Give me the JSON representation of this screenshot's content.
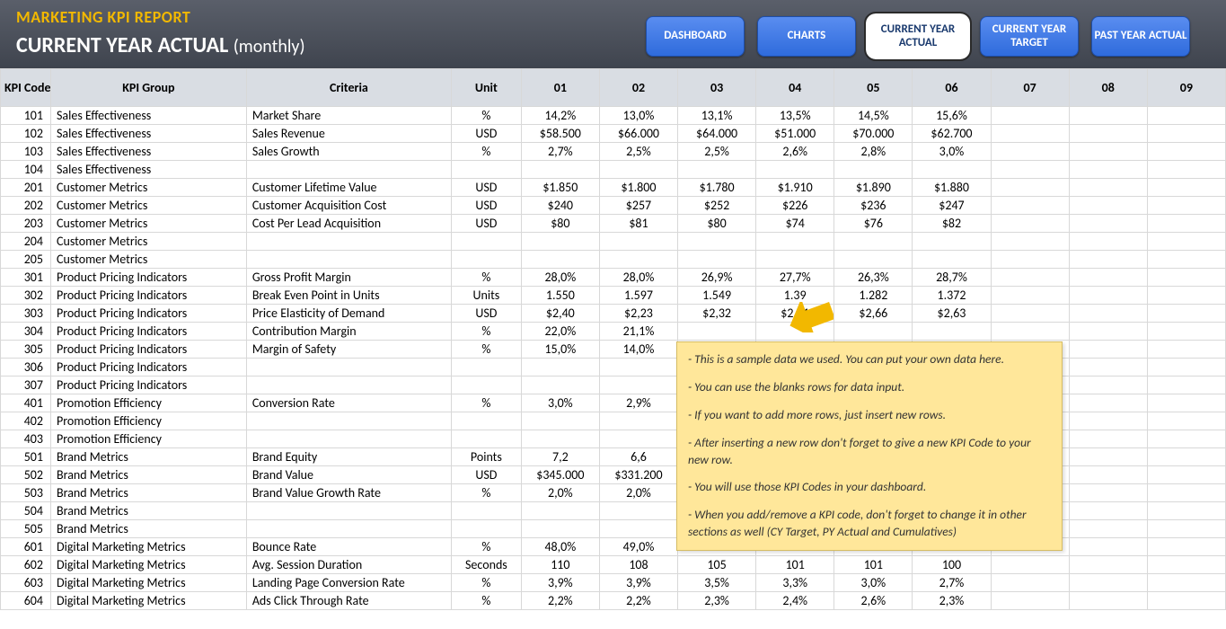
{
  "header": {
    "title": "MARKETING KPI REPORT",
    "subtitle_main": "CURRENT YEAR ACTUAL",
    "subtitle_suffix": "(monthly)"
  },
  "nav": {
    "dashboard": "DASHBOARD",
    "charts": "CHARTS",
    "cy_actual": "CURRENT YEAR ACTUAL",
    "cy_target": "CURRENT YEAR TARGET",
    "py_actual": "PAST YEAR ACTUAL"
  },
  "columns": {
    "code": "KPI Code",
    "group": "KPI Group",
    "criteria": "Criteria",
    "unit": "Unit",
    "m01": "01",
    "m02": "02",
    "m03": "03",
    "m04": "04",
    "m05": "05",
    "m06": "06",
    "m07": "07",
    "m08": "08",
    "m09": "09"
  },
  "rows": [
    {
      "code": "101",
      "group": "Sales Effectiveness",
      "criteria": "Market Share",
      "unit": "%",
      "v": [
        "14,2%",
        "13,0%",
        "13,1%",
        "13,5%",
        "14,5%",
        "15,6%",
        "",
        "",
        ""
      ]
    },
    {
      "code": "102",
      "group": "Sales Effectiveness",
      "criteria": "Sales Revenue",
      "unit": "USD",
      "v": [
        "$58.500",
        "$66.000",
        "$64.000",
        "$51.000",
        "$70.000",
        "$62.700",
        "",
        "",
        ""
      ]
    },
    {
      "code": "103",
      "group": "Sales Effectiveness",
      "criteria": "Sales Growth",
      "unit": "%",
      "v": [
        "2,7%",
        "2,5%",
        "2,5%",
        "2,6%",
        "2,8%",
        "3,0%",
        "",
        "",
        ""
      ]
    },
    {
      "code": "104",
      "group": "Sales Effectiveness",
      "criteria": "",
      "unit": "",
      "v": [
        "",
        "",
        "",
        "",
        "",
        "",
        "",
        "",
        ""
      ]
    },
    {
      "code": "201",
      "group": "Customer Metrics",
      "criteria": "Customer Lifetime Value",
      "unit": "USD",
      "v": [
        "$1.850",
        "$1.800",
        "$1.780",
        "$1.910",
        "$1.890",
        "$1.880",
        "",
        "",
        ""
      ]
    },
    {
      "code": "202",
      "group": "Customer Metrics",
      "criteria": "Customer Acquisition Cost",
      "unit": "USD",
      "v": [
        "$240",
        "$257",
        "$252",
        "$226",
        "$236",
        "$247",
        "",
        "",
        ""
      ]
    },
    {
      "code": "203",
      "group": "Customer Metrics",
      "criteria": "Cost Per Lead Acquisition",
      "unit": "USD",
      "v": [
        "$80",
        "$81",
        "$80",
        "$74",
        "$76",
        "$82",
        "",
        "",
        ""
      ]
    },
    {
      "code": "204",
      "group": "Customer Metrics",
      "criteria": "",
      "unit": "",
      "v": [
        "",
        "",
        "",
        "",
        "",
        "",
        "",
        "",
        ""
      ]
    },
    {
      "code": "205",
      "group": "Customer Metrics",
      "criteria": "",
      "unit": "",
      "v": [
        "",
        "",
        "",
        "",
        "",
        "",
        "",
        "",
        ""
      ]
    },
    {
      "code": "301",
      "group": "Product Pricing Indicators",
      "criteria": "Gross Profit Margin",
      "unit": "%",
      "v": [
        "28,0%",
        "28,0%",
        "26,9%",
        "27,7%",
        "26,3%",
        "28,7%",
        "",
        "",
        ""
      ]
    },
    {
      "code": "302",
      "group": "Product Pricing Indicators",
      "criteria": "Break Even Point in Units",
      "unit": "Units",
      "v": [
        "1.550",
        "1.597",
        "1.549",
        "1.39",
        "1.282",
        "1.372",
        "",
        "",
        ""
      ]
    },
    {
      "code": "303",
      "group": "Product Pricing Indicators",
      "criteria": "Price Elasticity of Demand",
      "unit": "USD",
      "v": [
        "$2,40",
        "$2,23",
        "$2,32",
        "$2,51",
        "$2,66",
        "$2,63",
        "",
        "",
        ""
      ]
    },
    {
      "code": "304",
      "group": "Product Pricing Indicators",
      "criteria": "Contribution Margin",
      "unit": "%",
      "v": [
        "22,0%",
        "21,1%",
        "",
        "",
        "",
        "",
        "",
        "",
        ""
      ]
    },
    {
      "code": "305",
      "group": "Product Pricing Indicators",
      "criteria": "Margin of Safety",
      "unit": "%",
      "v": [
        "15,0%",
        "14,0%",
        "",
        "",
        "",
        "",
        "",
        "",
        ""
      ]
    },
    {
      "code": "306",
      "group": "Product Pricing Indicators",
      "criteria": "",
      "unit": "",
      "v": [
        "",
        "",
        "",
        "",
        "",
        "",
        "",
        "",
        ""
      ]
    },
    {
      "code": "307",
      "group": "Product Pricing Indicators",
      "criteria": "",
      "unit": "",
      "v": [
        "",
        "",
        "",
        "",
        "",
        "",
        "",
        "",
        ""
      ]
    },
    {
      "code": "401",
      "group": "Promotion Efficiency",
      "criteria": "Conversion Rate",
      "unit": "%",
      "v": [
        "3,0%",
        "2,9%",
        "",
        "",
        "",
        "",
        "",
        "",
        ""
      ]
    },
    {
      "code": "402",
      "group": "Promotion Efficiency",
      "criteria": "",
      "unit": "",
      "v": [
        "",
        "",
        "",
        "",
        "",
        "",
        "",
        "",
        ""
      ]
    },
    {
      "code": "403",
      "group": "Promotion Efficiency",
      "criteria": "",
      "unit": "",
      "v": [
        "",
        "",
        "",
        "",
        "",
        "",
        "",
        "",
        ""
      ]
    },
    {
      "code": "501",
      "group": "Brand Metrics",
      "criteria": "Brand Equity",
      "unit": "Points",
      "v": [
        "7,2",
        "6,6",
        "",
        "",
        "",
        "",
        "",
        "",
        ""
      ]
    },
    {
      "code": "502",
      "group": "Brand Metrics",
      "criteria": "Brand Value",
      "unit": "USD",
      "v": [
        "$345.000",
        "$331.200",
        "",
        "",
        "",
        "",
        "",
        "",
        ""
      ]
    },
    {
      "code": "503",
      "group": "Brand Metrics",
      "criteria": "Brand Value Growth Rate",
      "unit": "%",
      "v": [
        "2,0%",
        "2,0%",
        "",
        "",
        "",
        "",
        "",
        "",
        ""
      ]
    },
    {
      "code": "504",
      "group": "Brand Metrics",
      "criteria": "",
      "unit": "",
      "v": [
        "",
        "",
        "",
        "",
        "",
        "",
        "",
        "",
        ""
      ]
    },
    {
      "code": "505",
      "group": "Brand Metrics",
      "criteria": "",
      "unit": "",
      "v": [
        "",
        "",
        "",
        "",
        "",
        "",
        "",
        "",
        ""
      ]
    },
    {
      "code": "601",
      "group": "Digital Marketing Metrics",
      "criteria": "Bounce Rate",
      "unit": "%",
      "v": [
        "48,0%",
        "49,0%",
        "",
        "",
        "",
        "",
        "",
        "",
        ""
      ]
    },
    {
      "code": "602",
      "group": "Digital Marketing Metrics",
      "criteria": "Avg. Session Duration",
      "unit": "Seconds",
      "v": [
        "110",
        "108",
        "105",
        "101",
        "101",
        "100",
        "",
        "",
        ""
      ]
    },
    {
      "code": "603",
      "group": "Digital Marketing Metrics",
      "criteria": "Landing Page Conversion Rate",
      "unit": "%",
      "v": [
        "3,9%",
        "3,9%",
        "3,5%",
        "3,3%",
        "3,0%",
        "2,7%",
        "",
        "",
        ""
      ]
    },
    {
      "code": "604",
      "group": "Digital Marketing Metrics",
      "criteria": "Ads Click Through Rate",
      "unit": "%",
      "v": [
        "2,2%",
        "2,2%",
        "2,3%",
        "2,4%",
        "2,6%",
        "2,3%",
        "",
        "",
        ""
      ]
    }
  ],
  "note": {
    "l1": "- This is a sample data we used. You can put your own data here.",
    "l2": "- You can use the blanks rows for data input.",
    "l3": "- If you want to add more rows, just insert new rows.",
    "l4": "- After inserting a new row don't forget to give a new KPI Code to your new row.",
    "l5": "- You will use those KPI Codes in your dashboard.",
    "l6": "- When you add/remove a KPI code, don't forget to change it in other sections as well (CY Target, PY Actual and Cumulatives)"
  }
}
